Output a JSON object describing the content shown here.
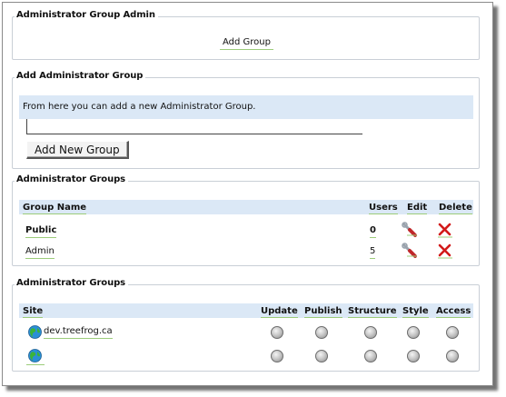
{
  "sections": {
    "group_admin": {
      "legend": "Administrator Group Admin",
      "add_group_link": "Add Group"
    },
    "add_group": {
      "legend": "Add Administrator Group",
      "info_text": "From here you can add a new Administrator Group.",
      "name_input_value": "",
      "name_input_placeholder": "",
      "add_button": "Add New Group"
    },
    "groups": {
      "legend": "Administrator Groups",
      "columns": [
        "Group Name",
        "Users",
        "Edit",
        "Delete"
      ],
      "rows": [
        {
          "name": "Public",
          "users": "0",
          "edit_icon": "wrench-edit-icon",
          "delete_icon": "red-x-delete-icon"
        },
        {
          "name": "Admin",
          "users": "5",
          "edit_icon": "wrench-edit-icon",
          "delete_icon": "red-x-delete-icon"
        }
      ]
    },
    "site_access": {
      "legend": "Administrator Groups",
      "columns": [
        "Site",
        "Update",
        "Publish",
        "Structure",
        "Style",
        "Access"
      ],
      "rows": [
        {
          "site": "dev.treefrog.ca",
          "site_icon": "globe-icon"
        },
        {
          "site": "",
          "site_icon": "globe-icon"
        }
      ]
    }
  },
  "colors": {
    "header_bg": "#dbe8f6",
    "underline_green": "#9ccc7a",
    "delete_red": "#d21a1a",
    "border": "#c9cfd6"
  }
}
